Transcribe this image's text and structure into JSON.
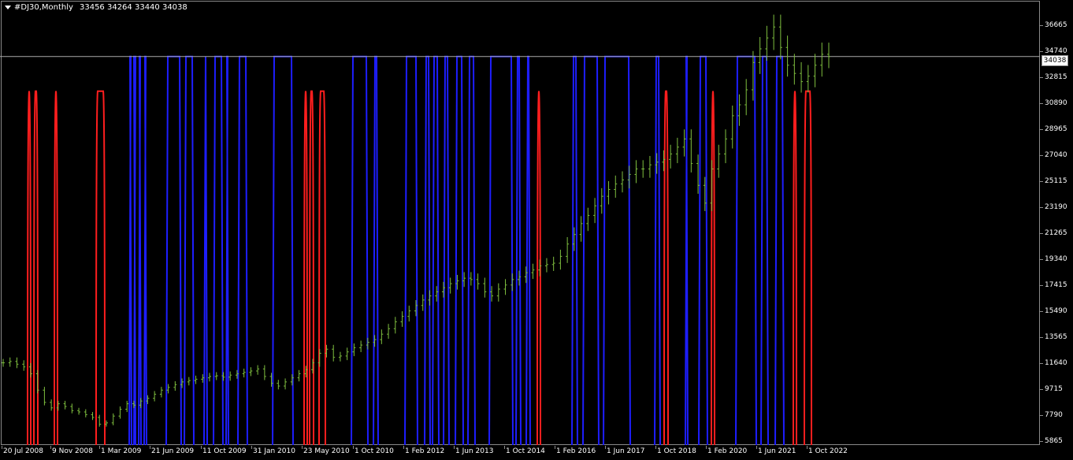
{
  "header": {
    "symbol_label": "#DJ30,Monthly",
    "ohlc_label": "33456 34264 33440 34038"
  },
  "current_price": "34038",
  "colors": {
    "background": "#000000",
    "candles": "#7fbf3f",
    "buy_signal": "#1e1eff",
    "sell_signal": "#ff1e1e",
    "price_line": "#aaaaaa"
  },
  "price_axis": {
    "ticks": [
      "36665",
      "34740",
      "32815",
      "30890",
      "28965",
      "27040",
      "25115",
      "23190",
      "21265",
      "19340",
      "17415",
      "15490",
      "13565",
      "11640",
      "9715",
      "7790",
      "5865"
    ]
  },
  "time_axis": {
    "ticks": [
      "20 Jul 2008",
      "9 Nov 2008",
      "1 Mar 2009",
      "21 Jun 2009",
      "11 Oct 2009",
      "31 Jan 2010",
      "23 May 2010",
      "1 Oct 2010",
      "1 Feb 2012",
      "1 Jun 2013",
      "1 Oct 2014",
      "1 Feb 2016",
      "1 Jun 2017",
      "1 Oct 2018",
      "1 Feb 2020",
      "1 Jun 2021",
      "1 Oct 2022"
    ]
  },
  "chart_data": {
    "type": "line",
    "ylim": [
      5865,
      37600
    ],
    "series": [
      {
        "values": [
          11600,
          11700,
          11500,
          11300,
          10800,
          9600,
          8700,
          8300,
          8600,
          8400,
          8100,
          8000,
          7800,
          7600,
          7100,
          7200,
          7700,
          8200,
          8600,
          8500,
          8800,
          9000,
          9300,
          9600,
          9800,
          10000,
          10200,
          10300,
          10400,
          10500,
          10600,
          10650,
          10550,
          10700,
          10800,
          10900,
          11000,
          11150,
          10600,
          10100,
          9900,
          10200,
          10500,
          10800,
          11100,
          11600,
          12300,
          12600,
          12000,
          12100,
          12400,
          12700,
          12900,
          13100,
          13300,
          13700,
          14100,
          14600,
          15000,
          15400,
          15800,
          16200,
          16500,
          16800,
          17100,
          17400,
          17600,
          17800,
          17700,
          17400,
          16800,
          16500,
          17000,
          17300,
          17700,
          17900,
          18200,
          18400,
          18700,
          18800,
          18900,
          19400,
          20300,
          21000,
          21800,
          22400,
          23100,
          23800,
          24300,
          24700,
          25000,
          25400,
          25800,
          25800,
          26100,
          26300,
          26500,
          26900,
          27400,
          28000,
          26200,
          24600,
          23300,
          25800,
          26900,
          28000,
          29700,
          30500,
          31600,
          33600,
          34600,
          35400,
          36200,
          34700,
          33400,
          32800,
          32200,
          32600,
          33400,
          34200,
          34038
        ]
      }
    ],
    "signals": {
      "upper_level": 34038,
      "lower_level": 31500,
      "blue_upper": [
        [
          164,
          167
        ],
        [
          170,
          172
        ],
        [
          176,
          179
        ],
        [
          183,
          186
        ],
        [
          211,
          230
        ],
        [
          234,
          246
        ],
        [
          259,
          263
        ],
        [
          271,
          283
        ],
        [
          287,
          290
        ],
        [
          302,
          314
        ],
        [
          346,
          372
        ],
        [
          446,
          467
        ],
        [
          474,
          480
        ],
        [
          514,
          530
        ],
        [
          539,
          546
        ],
        [
          549,
          557
        ],
        [
          563,
          570
        ],
        [
          578,
          588
        ],
        [
          594,
          603
        ],
        [
          621,
          651
        ],
        [
          655,
          661
        ],
        [
          668,
          673
        ],
        [
          726,
          733
        ],
        [
          740,
          760
        ],
        [
          766,
          800
        ],
        [
          831,
          838
        ],
        [
          870,
          873
        ],
        [
          887,
          898
        ],
        [
          934,
          960
        ],
        [
          966,
          975
        ],
        [
          984,
          995
        ]
      ],
      "red_lower": [
        [
          35,
          39
        ],
        [
          43,
          48
        ],
        [
          69,
          73
        ],
        [
          122,
          133
        ],
        [
          386,
          390
        ],
        [
          393,
          398
        ],
        [
          405,
          413
        ],
        [
          682,
          686
        ],
        [
          843,
          848
        ],
        [
          903,
          907
        ],
        [
          1007,
          1011
        ],
        [
          1021,
          1030
        ]
      ]
    }
  }
}
